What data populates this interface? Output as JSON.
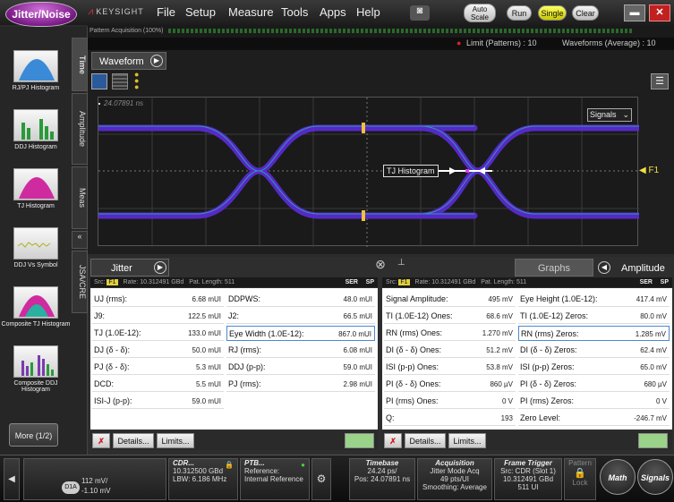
{
  "app": {
    "mode_button": "Jitter/Noise",
    "brand": "KEYSIGHT"
  },
  "menu": [
    "File",
    "Setup",
    "Measure",
    "Tools",
    "Apps",
    "Help"
  ],
  "toolbar": {
    "autoscale": "Auto Scale",
    "run": "Run",
    "single": "Single",
    "clear": "Clear"
  },
  "status": {
    "acquisition": "Pattern Acquisition (100%)",
    "limit": "Limit (Patterns) : 10",
    "waveforms": "Waveforms (Average) : 10"
  },
  "sidebar": {
    "items": [
      "RJ/PJ Histogram",
      "DDJ Histogram",
      "TJ Histogram",
      "DDJ Vs Symbol",
      "Composite TJ Histogram",
      "Composite DDJ Histogram"
    ],
    "more": "More (1/2)",
    "tabs": [
      "Time",
      "Amplitude",
      "Meas",
      "JSA/CRE"
    ]
  },
  "waveform": {
    "tab": "Waveform",
    "time_label": "24.07891 ns",
    "signals": "Signals",
    "histogram_label": "TJ Histogram",
    "marker": "F1"
  },
  "jitter": {
    "title": "Jitter",
    "src_label": "Src:",
    "src": "F1",
    "rate_label": "Rate:",
    "rate": "10.312491 GBd",
    "pat_label": "Pat. Length:",
    "pat": "511",
    "ser": "SER",
    "sp": "SP",
    "col1": [
      {
        "l": "UJ (rms):",
        "v": "6.68 mUI"
      },
      {
        "l": "J9:",
        "v": "122.5 mUI"
      },
      {
        "l": "TJ (1.0E-12):",
        "v": "133.0 mUI"
      },
      {
        "l": "DJ (δ - δ):",
        "v": "50.0 mUI"
      },
      {
        "l": "PJ (δ - δ):",
        "v": "5.3 mUI"
      },
      {
        "l": "DCD:",
        "v": "5.5 mUI"
      },
      {
        "l": "ISI-J (p-p):",
        "v": "59.0 mUI"
      }
    ],
    "col2": [
      {
        "l": "DDPWS:",
        "v": "48.0 mUI"
      },
      {
        "l": "J2:",
        "v": "66.5 mUI"
      },
      {
        "l": "Eye Width (1.0E-12):",
        "v": "867.0 mUI"
      },
      {
        "l": "RJ (rms):",
        "v": "6.08 mUI"
      },
      {
        "l": "DDJ (p-p):",
        "v": "59.0 mUI"
      },
      {
        "l": "PJ (rms):",
        "v": "2.98 mUI"
      }
    ]
  },
  "amplitude": {
    "graphs": "Graphs",
    "title": "Amplitude",
    "src_label": "Src:",
    "src": "F1",
    "rate_label": "Rate:",
    "rate": "10.312491 GBd",
    "pat_label": "Pat. Length:",
    "pat": "511",
    "ser": "SER",
    "sp": "SP",
    "col1": [
      {
        "l": "Signal Amplitude:",
        "v": "495 mV"
      },
      {
        "l": "TI (1.0E-12) Ones:",
        "v": "68.6 mV"
      },
      {
        "l": "RN (rms) Ones:",
        "v": "1.270 mV"
      },
      {
        "l": "DI (δ - δ) Ones:",
        "v": "51.2 mV"
      },
      {
        "l": "ISI (p-p) Ones:",
        "v": "53.8 mV"
      },
      {
        "l": "PI (δ - δ) Ones:",
        "v": "860 µV"
      },
      {
        "l": "PI (rms) Ones:",
        "v": "0 V"
      },
      {
        "l": "Q:",
        "v": "193"
      }
    ],
    "col2": [
      {
        "l": "Eye Height (1.0E-12):",
        "v": "417.4 mV"
      },
      {
        "l": "TI (1.0E-12) Zeros:",
        "v": "80.0 mV"
      },
      {
        "l": "RN (rms) Zeros:",
        "v": "1.285 mV"
      },
      {
        "l": "DI (δ - δ) Zeros:",
        "v": "62.4 mV"
      },
      {
        "l": "ISI (p-p) Zeros:",
        "v": "65.0 mV"
      },
      {
        "l": "PI (δ - δ) Zeros:",
        "v": "680 µV"
      },
      {
        "l": "PI (rms) Zeros:",
        "v": "0 V"
      },
      {
        "l": "Zero Level:",
        "v": "-246.7 mV"
      }
    ]
  },
  "buttons": {
    "details": "Details...",
    "limits": "Limits..."
  },
  "footer": {
    "channel": "D1A",
    "ch_scale": "112 mV/",
    "ch_offset": "-1.10 mV",
    "cdr_h": "CDR...",
    "cdr_rate": "10.312500 GBd",
    "cdr_lbw": "LBW: 6.186 MHz",
    "ptb_h": "PTB...",
    "ptb_ref": "Reference:",
    "ptb_val": "Internal Reference",
    "tb_h": "Timebase",
    "tb_1": "24.24 ps/",
    "tb_2": "Pos: 24.07891 ns",
    "acq_h": "Acquisition",
    "acq_1": "Jitter Mode Acq",
    "acq_2": "49 pts/UI",
    "acq_3": "Smoothing: Average",
    "ft_h": "Frame Trigger",
    "ft_1": "Src: CDR (Slot 1)",
    "ft_2": "10.312491 GBd",
    "ft_3": "511 UI",
    "pattern": "Pattern",
    "lock": "Lock",
    "math": "Math",
    "signals": "Signals"
  }
}
